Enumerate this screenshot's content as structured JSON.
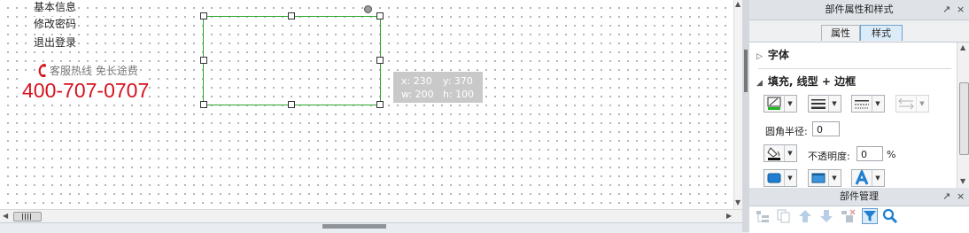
{
  "canvas": {
    "menu": [
      "基本信息",
      "修改密码",
      "退出登录"
    ],
    "hotline_label": "客服热线  免长途费",
    "phone_number": "400-707-0707",
    "phone_color": "#d6121e",
    "selection_color": "#2ea82e",
    "coord_tooltip": {
      "x": "x: 230",
      "y": "y: 370",
      "w": "w: 200",
      "h": "h: 100"
    }
  },
  "props_panel": {
    "title": "部件属性和样式",
    "tabs": [
      {
        "label": "属性",
        "active": false
      },
      {
        "label": "样式",
        "active": true
      }
    ],
    "sections": {
      "font": "字体",
      "fill": "填充, 线型 + 边框"
    },
    "corner_radius": {
      "label": "圆角半径:",
      "value": "0"
    },
    "opacity": {
      "label": "不透明度:",
      "value": "0",
      "unit": "%"
    },
    "icons": [
      "fill-color-icon",
      "line-weight-icon",
      "line-style-icon",
      "arrow-style-icon",
      "border-color-icon",
      "shadow-icon",
      "inner-shadow-icon",
      "text-shadow-icon"
    ],
    "pin_icon": "↗",
    "close_icon": "×"
  },
  "widget_manager": {
    "title": "部件管理",
    "icons": [
      "order-icon",
      "copy-icon",
      "move-up-icon",
      "move-down-icon",
      "delete-icon",
      "filter-icon",
      "search-icon"
    ],
    "accent": "#1e7fd0"
  }
}
